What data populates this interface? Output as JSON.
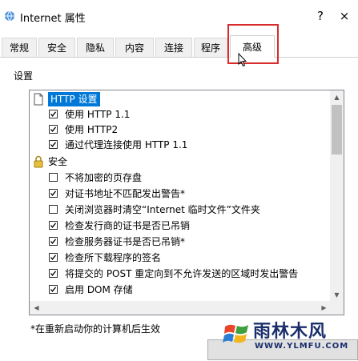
{
  "window": {
    "title": "Internet 属性",
    "help_label": "?",
    "close_label": "×"
  },
  "tabs": [
    {
      "label": "常规",
      "active": false
    },
    {
      "label": "安全",
      "active": false
    },
    {
      "label": "隐私",
      "active": false
    },
    {
      "label": "内容",
      "active": false
    },
    {
      "label": "连接",
      "active": false
    },
    {
      "label": "程序",
      "active": false
    },
    {
      "label": "高级",
      "active": true
    }
  ],
  "settings": {
    "group_label": "设置",
    "items": [
      {
        "type": "category",
        "icon": "page-icon",
        "label": "HTTP 设置",
        "selected": true
      },
      {
        "type": "checkbox",
        "label": "使用 HTTP 1.1",
        "checked": true
      },
      {
        "type": "checkbox",
        "label": "使用 HTTP2",
        "checked": true
      },
      {
        "type": "checkbox",
        "label": "通过代理连接使用 HTTP 1.1",
        "checked": true
      },
      {
        "type": "category",
        "icon": "lock-icon",
        "label": "安全",
        "selected": false
      },
      {
        "type": "checkbox",
        "label": "不将加密的页存盘",
        "checked": false
      },
      {
        "type": "checkbox",
        "label": "对证书地址不匹配发出警告*",
        "checked": true
      },
      {
        "type": "checkbox",
        "label": "关闭浏览器时清空“Internet 临时文件”文件夹",
        "checked": false
      },
      {
        "type": "checkbox",
        "label": "检查发行商的证书是否已吊销",
        "checked": true
      },
      {
        "type": "checkbox",
        "label": "检查服务器证书是否已吊销*",
        "checked": true
      },
      {
        "type": "checkbox",
        "label": "检查所下载程序的签名",
        "checked": true
      },
      {
        "type": "checkbox",
        "label": "将提交的 POST 重定向到不允许发送的区域时发出警告",
        "checked": true
      },
      {
        "type": "checkbox",
        "label": "启用 DOM 存储",
        "checked": true
      }
    ]
  },
  "footer_note": "*在重新启动你的计算机后生效",
  "watermark": {
    "main": "雨林木风",
    "sub": "WWW.YLMFU.COM"
  },
  "colors": {
    "highlight_box": "#d92b2b",
    "selection": "#0078d7"
  }
}
